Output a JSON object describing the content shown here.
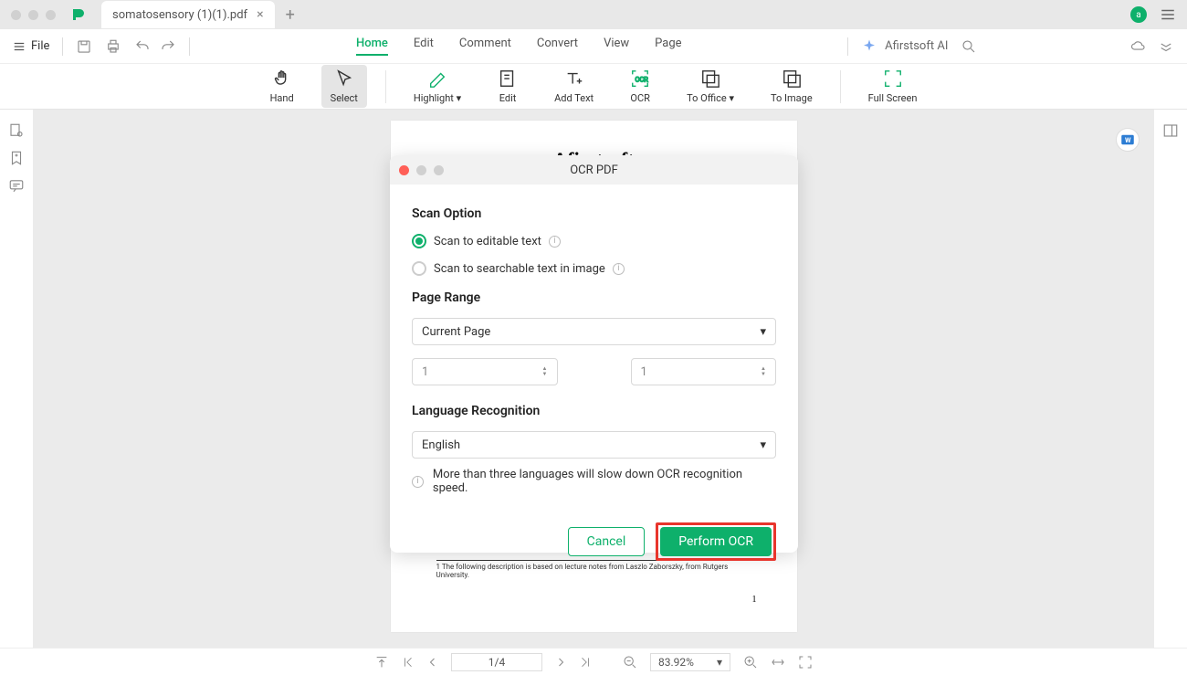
{
  "tab": {
    "title": "somatosensory (1)(1).pdf"
  },
  "menu": {
    "file": "File"
  },
  "topmenu": {
    "home": "Home",
    "edit": "Edit",
    "comment": "Comment",
    "convert": "Convert",
    "view": "View",
    "page": "Page"
  },
  "ai": {
    "label": "Afirstsoft AI"
  },
  "avatar": {
    "letter": "a"
  },
  "tools": {
    "hand": "Hand",
    "select": "Select",
    "highlight": "Highlight",
    "edit": "Edit",
    "addtext": "Add Text",
    "ocr": "OCR",
    "tooffice": "To Office",
    "toimage": "To Image",
    "fullscreen": "Full Screen"
  },
  "page_preview": {
    "title": "Afirstsoft",
    "footnote": "1 The following description is based on lecture notes from Laszlo Zaborszky, from Rutgers University.",
    "pagenum": "1"
  },
  "dialog": {
    "title": "OCR PDF",
    "scan_option_title": "Scan Option",
    "scan_editable": "Scan to editable text",
    "scan_searchable": "Scan to searchable text in image",
    "page_range_title": "Page Range",
    "page_range_value": "Current Page",
    "range_from": "1",
    "range_to": "1",
    "language_title": "Language Recognition",
    "language_value": "English",
    "warning": "More than three languages will slow down OCR recognition speed.",
    "cancel": "Cancel",
    "perform": "Perform OCR"
  },
  "status": {
    "page": "1/4",
    "zoom": "83.92%"
  }
}
